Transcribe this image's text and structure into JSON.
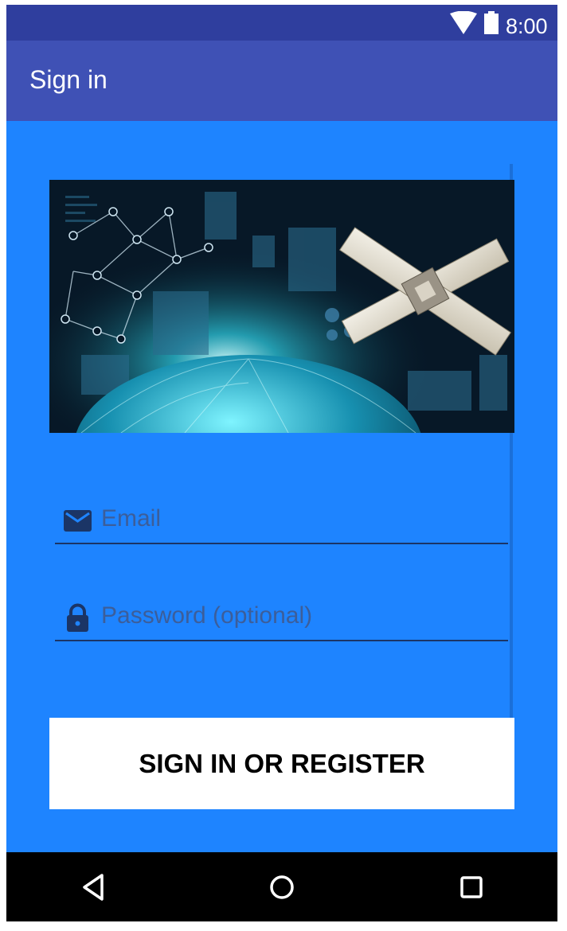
{
  "status_bar": {
    "time": "8:00",
    "icons": [
      "wifi-icon",
      "battery-icon"
    ]
  },
  "app_bar": {
    "title": "Sign in"
  },
  "hero_image": {
    "description_icon": "satellite-network-banner"
  },
  "form": {
    "email": {
      "placeholder": "Email",
      "value": "",
      "icon": "mail-icon"
    },
    "password": {
      "placeholder": "Password (optional)",
      "value": "",
      "icon": "lock-icon"
    },
    "submit_label": "SIGN IN OR REGISTER"
  },
  "nav_bar": {
    "buttons": [
      "back-icon",
      "home-icon",
      "recents-icon"
    ]
  },
  "colors": {
    "status_bar": "#2f3e9e",
    "app_bar": "#3f51b5",
    "content_background": "#1e84ff",
    "field_text": "#1b3566",
    "button_background": "#ffffff",
    "nav_bar": "#000000"
  }
}
